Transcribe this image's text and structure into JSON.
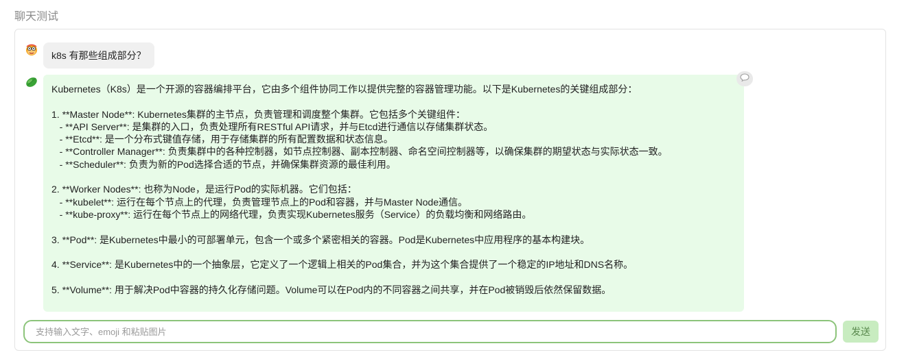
{
  "page": {
    "title": "聊天测试"
  },
  "conversation": {
    "user_message": "k8s 有那些组成部分？",
    "bot_message": "Kubernetes（K8s）是一个开源的容器编排平台，它由多个组件协同工作以提供完整的容器管理功能。以下是Kubernetes的关键组成部分：\n\n1. **Master Node**: Kubernetes集群的主节点，负责管理和调度整个集群。它包括多个关键组件：\n   - **API Server**: 是集群的入口，负责处理所有RESTful API请求，并与Etcd进行通信以存储集群状态。\n   - **Etcd**: 是一个分布式键值存储，用于存储集群的所有配置数据和状态信息。\n   - **Controller Manager**: 负责集群中的各种控制器，如节点控制器、副本控制器、命名空间控制器等，以确保集群的期望状态与实际状态一致。\n   - **Scheduler**: 负责为新的Pod选择合适的节点，并确保集群资源的最佳利用。\n\n2. **Worker Nodes**: 也称为Node，是运行Pod的实际机器。它们包括：\n   - **kubelet**: 运行在每个节点上的代理，负责管理节点上的Pod和容器，并与Master Node通信。\n   - **kube-proxy**: 运行在每个节点上的网络代理，负责实现Kubernetes服务（Service）的负载均衡和网络路由。\n\n3. **Pod**: 是Kubernetes中最小的可部署单元，包含一个或多个紧密相关的容器。Pod是Kubernetes中应用程序的基本构建块。\n\n4. **Service**: 是Kubernetes中的一个抽象层，它定义了一个逻辑上相关的Pod集合，并为这个集合提供了一个稳定的IP地址和DNS名称。\n\n5. **Volume**: 用于解决Pod中容器的持久化存储问题。Volume可以在Pod内的不同容器之间共享，并在Pod被销毁后依然保留数据。"
  },
  "icons": {
    "user_avatar": "cartoon-face-icon",
    "bot_avatar": "green-leaf-icon",
    "copy": "speech-bubble-icon"
  },
  "composer": {
    "placeholder": "支持输入文字、emoji 和粘贴图片",
    "value": "",
    "send_label": "发送"
  },
  "colors": {
    "bot_bubble": "#e8fbe8",
    "user_bubble": "#f0f0f0",
    "input_border": "#8cc47a",
    "send_button": "#c8ecc0"
  }
}
